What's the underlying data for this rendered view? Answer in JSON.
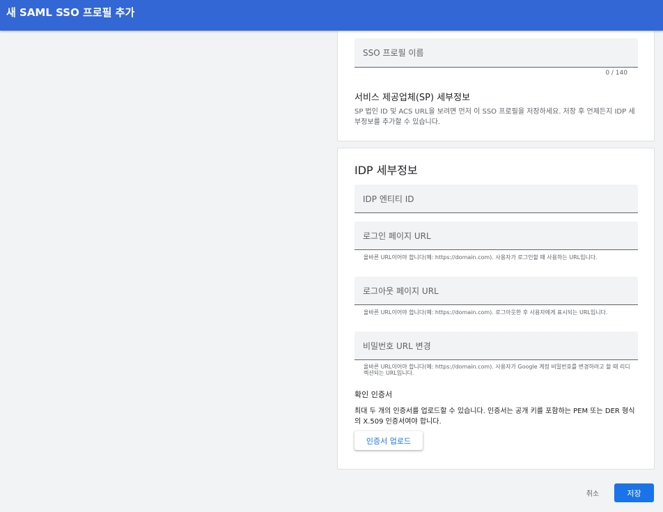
{
  "header": {
    "title": "새 SAML SSO 프로필 추가"
  },
  "sso_profile": {
    "name_placeholder": "SSO 프로필 이름",
    "char_counter": "0 / 140"
  },
  "sp_details": {
    "title": "서비스 제공업체(SP) 세부정보",
    "description": "SP 법인 ID 및 ACS URL을 보려면 먼저 이 SSO 프로필을 저장하세요. 저장 후 언제든지 IDP 세부정보를 추가할 수 있습니다."
  },
  "idp_details": {
    "title": "IDP 세부정보",
    "entity_id_placeholder": "IDP 엔티티 ID",
    "login_url_placeholder": "로그인 페이지 URL",
    "login_url_helper": "올바른 URL이어야 합니다(예: https://domain.com). 사용자가 로그인할 때 사용하는 URL입니다.",
    "logout_url_placeholder": "로그아웃 페이지 URL",
    "logout_url_helper": "올바른 URL이어야 합니다(예: https://domain.com). 로그아웃한 후 사용자에게 표시되는 URL입니다.",
    "password_url_placeholder": "비밀번호 URL 변경",
    "password_url_helper": "올바른 URL이어야 합니다(예: https://domain.com). 사용자가 Google 계정 비밀번호를 변경하려고 할 때 리디렉션되는 URL입니다.",
    "cert_title": "확인 인증서",
    "cert_description": "최대 두 개의 인증서를 업로드할 수 있습니다. 인증서는 공개 키를 포함하는 PEM 또는 DER 형식의 X.509 인증서여야 합니다.",
    "upload_label": "인증서 업로드"
  },
  "footer": {
    "cancel_label": "취소",
    "save_label": "저장"
  },
  "colors": {
    "header_bg": "#3367d6",
    "primary": "#1a73e8",
    "page_bg": "#f1f3f4"
  }
}
